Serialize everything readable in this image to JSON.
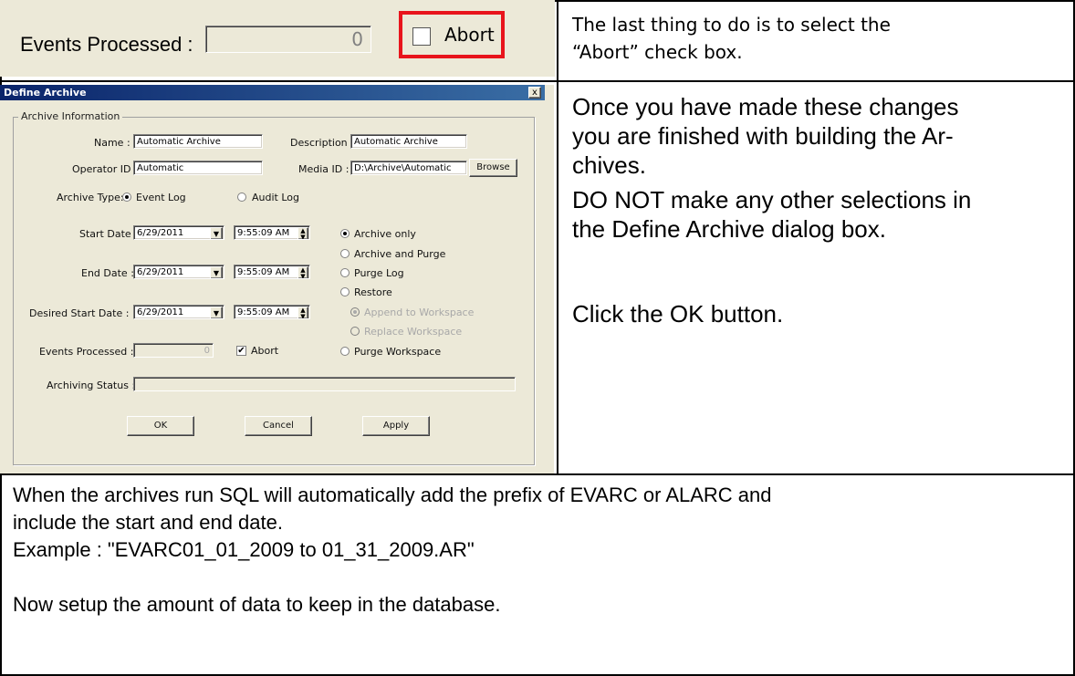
{
  "snippet": {
    "events_label": "Events Processed :",
    "events_value": "0",
    "abort_label": "Abort",
    "highlight_color": "#e8141c"
  },
  "right_text_1": {
    "line1": "The last thing to do is to select the",
    "line2": "“Abort” check box."
  },
  "right_text_2": {
    "para1_line1": "Once you have made these changes",
    "para1_line2": "you are finished with building the Ar-",
    "para1_line3": "chives.",
    "para2_line1": "DO NOT make any other selections in",
    "para2_line2": "the Define Archive dialog box.",
    "para3": "Click the OK button."
  },
  "dialog": {
    "title": "Define Archive",
    "close_glyph": "x",
    "group_title": "Archive Information",
    "name_label": "Name :",
    "name_value": "Automatic Archive",
    "description_label": "Description :",
    "description_value": "Automatic Archive",
    "operator_label": "Operator ID :",
    "operator_value": "Automatic",
    "media_label": "Media ID :",
    "media_value": "D:\\Archive\\Automatic",
    "browse_label": "Browse",
    "archive_type_label": "Archive Type:",
    "event_log_label": "Event Log",
    "audit_log_label": "Audit Log",
    "start_date_label": "Start Date :",
    "start_date_value": "6/29/2011",
    "start_time_value": "9:55:09 AM",
    "end_date_label": "End Date :",
    "end_date_value": "6/29/2011",
    "end_time_value": "9:55:09 AM",
    "desired_start_label": "Desired Start Date :",
    "desired_date_value": "6/29/2011",
    "desired_time_value": "9:55:09 AM",
    "events_processed_label": "Events Processed :",
    "events_processed_value": "0",
    "abort_label": "Abort",
    "option_archive_only": "Archive only",
    "option_archive_purge": "Archive and Purge",
    "option_purge_log": "Purge Log",
    "option_restore": "Restore",
    "option_append": "Append to Workspace",
    "option_replace": "Replace Workspace",
    "option_purge_workspace": "Purge Workspace",
    "archiving_status_label": "Archiving Status :",
    "ok_label": "OK",
    "cancel_label": "Cancel",
    "apply_label": "Apply"
  },
  "bottom_text": {
    "line1": "When the archives run SQL will automatically add the prefix of EVARC or ALARC and",
    "line2": "include the start and end date.",
    "line3": "Example : \"EVARC01_01_2009 to 01_31_2009.AR\"",
    "line4": "Now setup the amount of data to keep in the database."
  }
}
